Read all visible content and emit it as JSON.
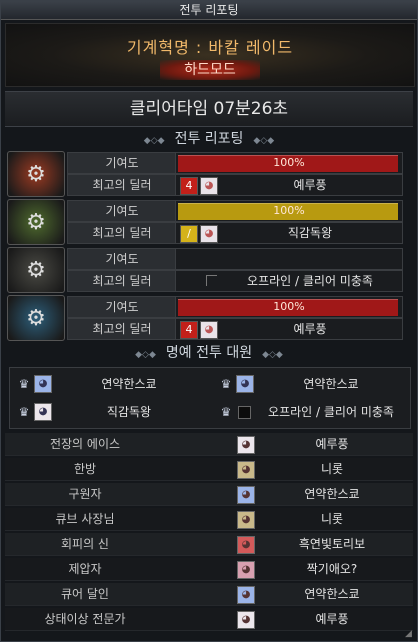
{
  "window": {
    "title": "전투 리포팅"
  },
  "raid": {
    "name": "기계혁명 : 바칼 레이드",
    "mode": "하드모드"
  },
  "clear_time": "클리어타임  07분26초",
  "report_section": {
    "title": "전투 리포팅"
  },
  "bosses": [
    {
      "icon": "fire-boss-portrait-icon",
      "color": "#9a3a22",
      "contribution_label": "기여도",
      "contribution_text": "100%",
      "contribution_pct": 100,
      "bar_color": "#a01818",
      "dealer_label": "최고의 딜러",
      "class_icon": "red-class-icon",
      "class_glyph": "4",
      "class_color": "#c2201a",
      "dealer_name": "예루풍"
    },
    {
      "icon": "wind-boss-portrait-icon",
      "color": "#4f6b2e",
      "contribution_label": "기여도",
      "contribution_text": "100%",
      "contribution_pct": 100,
      "bar_color": "#b89a10",
      "dealer_label": "최고의 딜러",
      "class_icon": "yellow-class-icon",
      "class_glyph": "/",
      "class_color": "#d4b21a",
      "dealer_name": "직감독왕"
    },
    {
      "icon": "dark-boss-portrait-icon",
      "color": "#4a4a44",
      "contribution_label": "기여도",
      "contribution_text": "",
      "contribution_pct": 0,
      "bar_color": "#1a1c1f",
      "dealer_label": "최고의 딜러",
      "class_icon": "",
      "class_glyph": "",
      "class_color": "",
      "dealer_name": "오프라인 / 클리어 미충족"
    },
    {
      "icon": "ice-boss-portrait-icon",
      "color": "#2d5e7a",
      "contribution_label": "기여도",
      "contribution_text": "100%",
      "contribution_pct": 100,
      "bar_color": "#a01818",
      "dealer_label": "최고의 딜러",
      "class_icon": "red-class-icon",
      "class_glyph": "4",
      "class_color": "#c2201a",
      "dealer_name": "예루풍"
    }
  ],
  "honor_section": {
    "title": "명예 전투 대원"
  },
  "honor_members": [
    {
      "name": "연약한스쿄",
      "avatar_bg": "#9bb4e8",
      "offline": false
    },
    {
      "name": "연약한스쿄",
      "avatar_bg": "#9bb4e8",
      "offline": false
    },
    {
      "name": "직감독왕",
      "avatar_bg": "#ece6ec",
      "offline": false
    },
    {
      "name": "오프라인 / 클리어 미충족",
      "avatar_bg": "#0c0c0c",
      "offline": true
    }
  ],
  "awards": [
    {
      "title": "전장의 에이스",
      "name": "예루풍",
      "avatar_bg": "#ece6ec"
    },
    {
      "title": "한방",
      "name": "니롯",
      "avatar_bg": "#c9b98a"
    },
    {
      "title": "구원자",
      "name": "연약한스쿄",
      "avatar_bg": "#9bb4e8"
    },
    {
      "title": "큐브 사장님",
      "name": "니롯",
      "avatar_bg": "#c9b98a"
    },
    {
      "title": "회피의 신",
      "name": "흑연빛토리보",
      "avatar_bg": "#d35a5a"
    },
    {
      "title": "제압자",
      "name": "짝기애오?",
      "avatar_bg": "#d8a0b0"
    },
    {
      "title": "큐어 달인",
      "name": "연약한스쿄",
      "avatar_bg": "#9bb4e8"
    },
    {
      "title": "상태이상 전문가",
      "name": "예루풍",
      "avatar_bg": "#ece6ec"
    }
  ]
}
